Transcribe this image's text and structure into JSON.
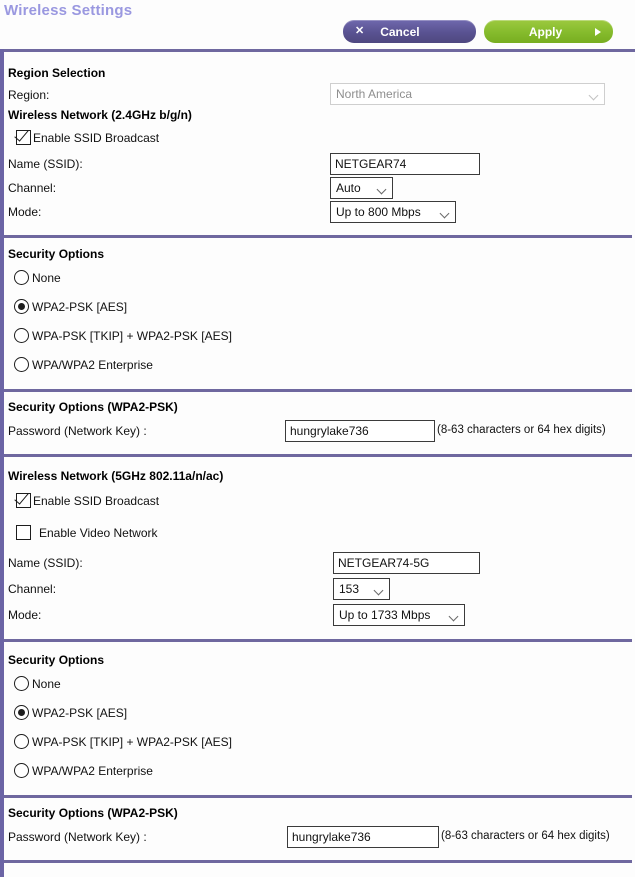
{
  "header": {
    "title": "Wireless Settings",
    "cancel_label": "Cancel",
    "cancel_icon": "close-x-icon",
    "apply_label": "Apply",
    "apply_icon": "arrow-right-icon",
    "cancel_color": "#595291",
    "apply_color": "#85bb2c",
    "title_color": "#9a98e0",
    "rule_color": "#6f689f"
  },
  "region": {
    "heading": "Region Selection",
    "label": "Region:",
    "value": "North America",
    "disabled": true
  },
  "network_24": {
    "heading": "Wireless Network (2.4GHz b/g/n)",
    "ssid_broadcast_label": "Enable SSID Broadcast",
    "ssid_broadcast_checked": true,
    "name_label": "Name (SSID):",
    "name_value": "NETGEAR74",
    "channel_label": "Channel:",
    "channel_value": "Auto",
    "mode_label": "Mode:",
    "mode_value": "Up to 800 Mbps"
  },
  "security_24": {
    "heading": "Security Options",
    "options": [
      {
        "label": "None",
        "selected": false
      },
      {
        "label": "WPA2-PSK [AES]",
        "selected": true
      },
      {
        "label": "WPA-PSK [TKIP] + WPA2-PSK [AES]",
        "selected": false
      },
      {
        "label": "WPA/WPA2 Enterprise",
        "selected": false
      }
    ]
  },
  "psk_24": {
    "heading": "Security Options (WPA2-PSK)",
    "password_label": "Password (Network Key) :",
    "password_value": "hungrylake736",
    "hint": "(8-63 characters or 64 hex digits)"
  },
  "network_5": {
    "heading": "Wireless Network (5GHz 802.11a/n/ac)",
    "ssid_broadcast_label": "Enable SSID Broadcast",
    "ssid_broadcast_checked": true,
    "video_network_label": "Enable Video Network",
    "video_network_checked": false,
    "name_label": "Name (SSID):",
    "name_value": "NETGEAR74-5G",
    "channel_label": "Channel:",
    "channel_value": "153",
    "mode_label": "Mode:",
    "mode_value": "Up to 1733 Mbps"
  },
  "security_5": {
    "heading": "Security Options",
    "options": [
      {
        "label": "None",
        "selected": false
      },
      {
        "label": "WPA2-PSK [AES]",
        "selected": true
      },
      {
        "label": "WPA-PSK [TKIP] + WPA2-PSK [AES]",
        "selected": false
      },
      {
        "label": "WPA/WPA2 Enterprise",
        "selected": false
      }
    ]
  },
  "psk_5": {
    "heading": "Security Options (WPA2-PSK)",
    "password_label": "Password (Network Key) :",
    "password_value": "hungrylake736",
    "hint": "(8-63 characters or 64 hex digits)"
  }
}
